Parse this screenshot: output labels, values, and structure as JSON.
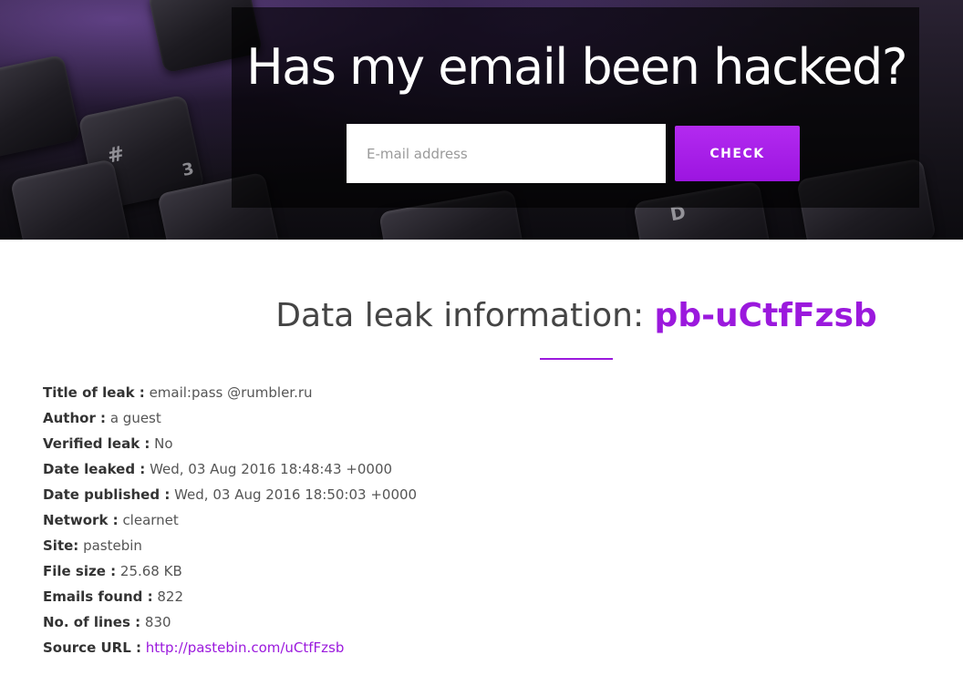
{
  "hero": {
    "title": "Has my email been hacked?",
    "search": {
      "placeholder": "E-mail address",
      "value": ""
    },
    "check_label": "CHECK"
  },
  "section": {
    "heading_prefix": "Data leak information: ",
    "leak_id": "pb-uCtfFzsb"
  },
  "details": [
    {
      "label": "Title of leak :",
      "value": "email:pass @rumbler.ru"
    },
    {
      "label": "Author :",
      "value": "a guest"
    },
    {
      "label": "Verified leak :",
      "value": "No"
    },
    {
      "label": "Date leaked :",
      "value": "Wed, 03 Aug 2016 18:48:43 +0000"
    },
    {
      "label": "Date published :",
      "value": "Wed, 03 Aug 2016 18:50:03 +0000"
    },
    {
      "label": "Network :",
      "value": "clearnet"
    },
    {
      "label": "Site:",
      "value": "pastebin"
    },
    {
      "label": "File size :",
      "value": "25.68 KB"
    },
    {
      "label": "Emails found :",
      "value": "822"
    },
    {
      "label": "No. of lines :",
      "value": "830"
    },
    {
      "label": "Source URL :",
      "value": "http://pastebin.com/uCtfFzsb"
    }
  ],
  "colors": {
    "accent": "#9b19dd",
    "button": "#a61ee6",
    "heading_text": "#444444",
    "hero_dark": "#0c0b0f"
  }
}
